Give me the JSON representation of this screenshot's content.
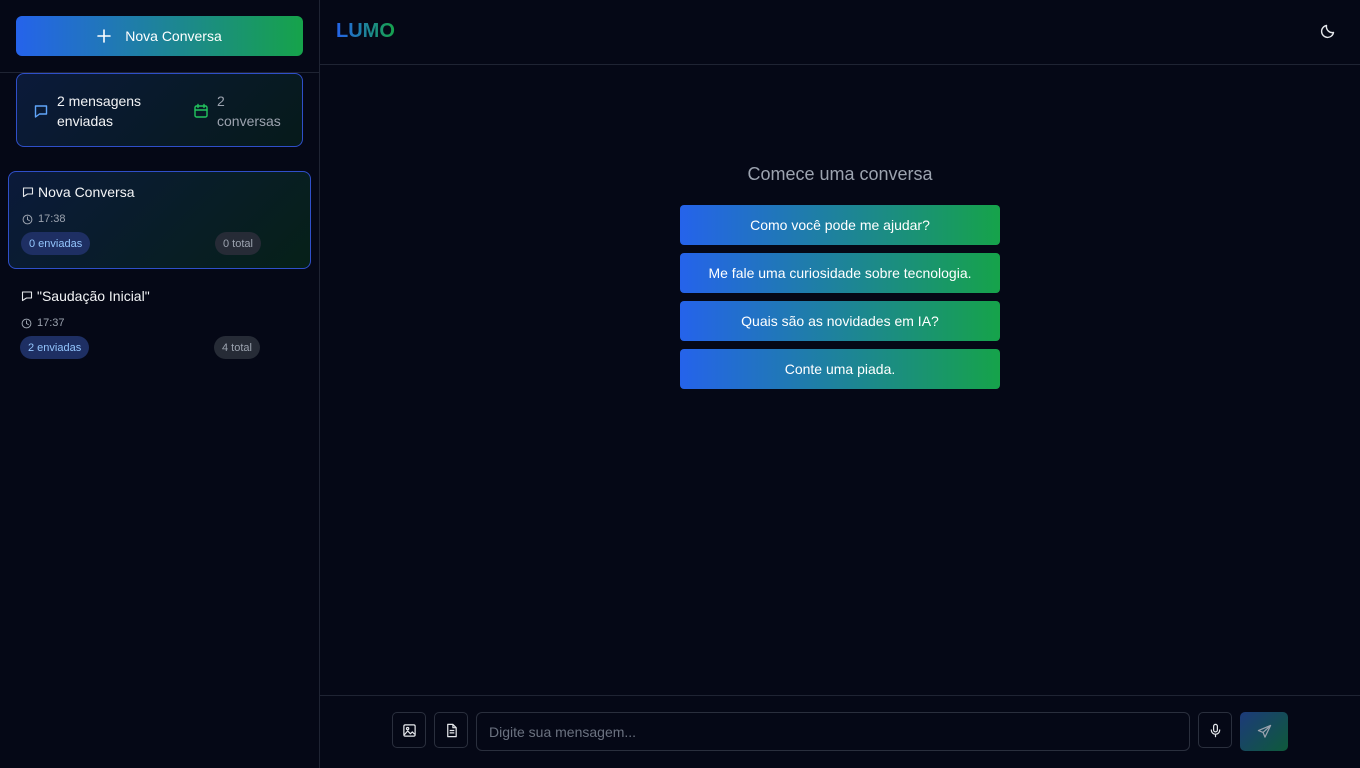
{
  "sidebar": {
    "new_chat_label": "Nova Conversa",
    "stats": {
      "messages_label": "2 mensagens enviadas",
      "conversations_label": "2 conversas"
    },
    "conversations": [
      {
        "title": "Nova Conversa",
        "time": "17:38",
        "sent": "0 enviadas",
        "total": "0 total",
        "active": true
      },
      {
        "title": "\"Saudação Inicial\"",
        "time": "17:37",
        "sent": "2 enviadas",
        "total": "4 total",
        "active": false
      }
    ]
  },
  "header": {
    "brand": "LUMO",
    "theme_icon": "moon-icon"
  },
  "main": {
    "welcome_title": "Comece uma conversa",
    "suggestions": [
      "Como você pode me ajudar?",
      "Me fale uma curiosidade sobre tecnologia.",
      "Quais são as novidades em IA?",
      "Conte uma piada."
    ]
  },
  "composer": {
    "placeholder": "Digite sua mensagem...",
    "value": "",
    "icons": [
      "image-icon",
      "file-icon",
      "microphone-icon",
      "send-icon"
    ]
  },
  "colors": {
    "background": "#050816",
    "gradient_start": "#2563eb",
    "gradient_end": "#16a34a",
    "accent_border": "#2f4fc9"
  }
}
